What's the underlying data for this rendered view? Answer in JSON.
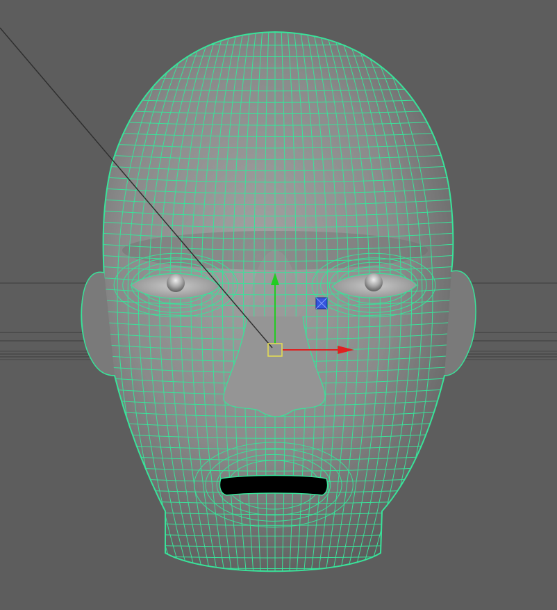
{
  "viewport": {
    "background": "#5d5d5d",
    "view": "front"
  },
  "model": {
    "name": "head",
    "display_mode": "smooth-shade-with-wireframe",
    "wireframe_color": "#39e39a",
    "selected": true,
    "features": [
      "cranium",
      "left-ear",
      "right-ear",
      "left-eye",
      "right-eye",
      "nose",
      "mouth",
      "neck"
    ]
  },
  "manipulator": {
    "type": "move-tool",
    "y_axis_color": "#22cc22",
    "x_axis_color": "#e02020",
    "center_color": "#e8e050"
  },
  "icons": {
    "light_locator": "blue-light-icon"
  }
}
